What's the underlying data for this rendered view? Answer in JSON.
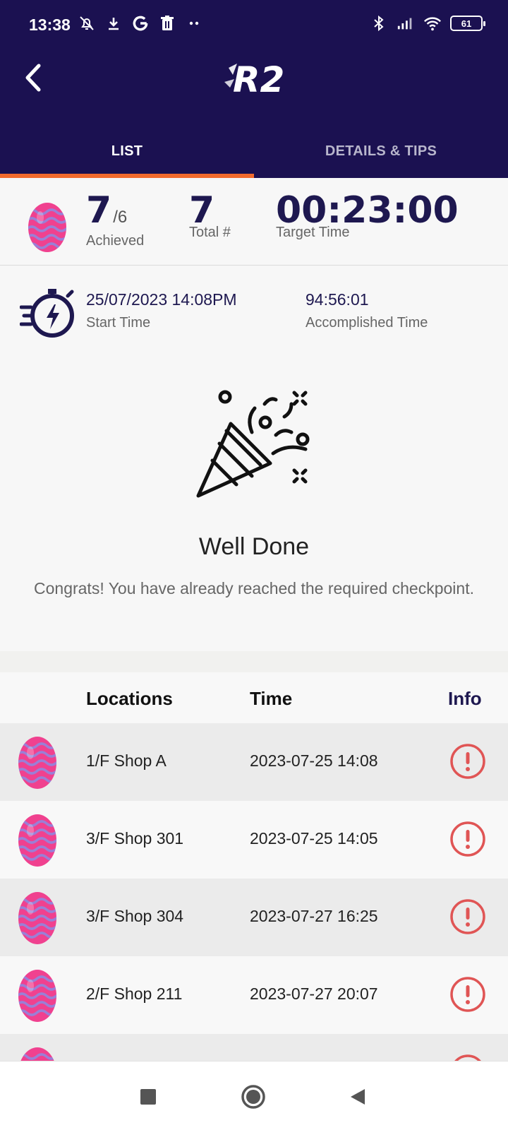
{
  "status_bar": {
    "time": "13:38",
    "battery": "61",
    "left_icons": [
      "mute-icon",
      "download-icon",
      "google-icon",
      "trash-icon",
      "more-dots-icon"
    ],
    "right_icons": [
      "bluetooth-icon",
      "signal-icon",
      "wifi-icon",
      "battery-icon"
    ]
  },
  "header": {
    "logo_text": "R2",
    "back_icon": "chevron-left-icon"
  },
  "tabs": [
    {
      "label": "LIST",
      "active": true
    },
    {
      "label": "DETAILS & TIPS",
      "active": false
    }
  ],
  "stats": {
    "achieved_value": "7",
    "achieved_denominator": "/6",
    "achieved_label": "Achieved",
    "total_value": "7",
    "total_label": "Total #",
    "target_time_value": "00:23:00",
    "target_time_label": "Target Time"
  },
  "timing": {
    "start_time_value": "25/07/2023 14:08PM",
    "start_time_label": "Start Time",
    "accomplished_time_value": "94:56:01",
    "accomplished_time_label": "Accomplished Time"
  },
  "congrats": {
    "icon": "party-popper-icon",
    "title": "Well Done",
    "message": "Congrats! You have already reached the required checkpoint."
  },
  "table": {
    "headers": {
      "locations": "Locations",
      "time": "Time",
      "info": "Info"
    },
    "rows": [
      {
        "location": "1/F Shop A",
        "time": "2023-07-25 14:08"
      },
      {
        "location": "3/F Shop 301",
        "time": "2023-07-25 14:05"
      },
      {
        "location": "3/F Shop 304",
        "time": "2023-07-27 16:25"
      },
      {
        "location": "2/F Shop 211",
        "time": "2023-07-27 20:07"
      },
      {
        "location": "",
        "time": ""
      }
    ]
  },
  "colors": {
    "header_bg": "#1b1151",
    "tab_indicator": "#f26a2d",
    "accent_text": "#1e1850",
    "info_icon": "#e05555",
    "egg_pink": "#f0418f",
    "egg_wave": "#9b7fd6"
  },
  "nav_bar": {
    "icons": [
      "recents-square-icon",
      "home-circle-icon",
      "back-triangle-icon"
    ]
  }
}
